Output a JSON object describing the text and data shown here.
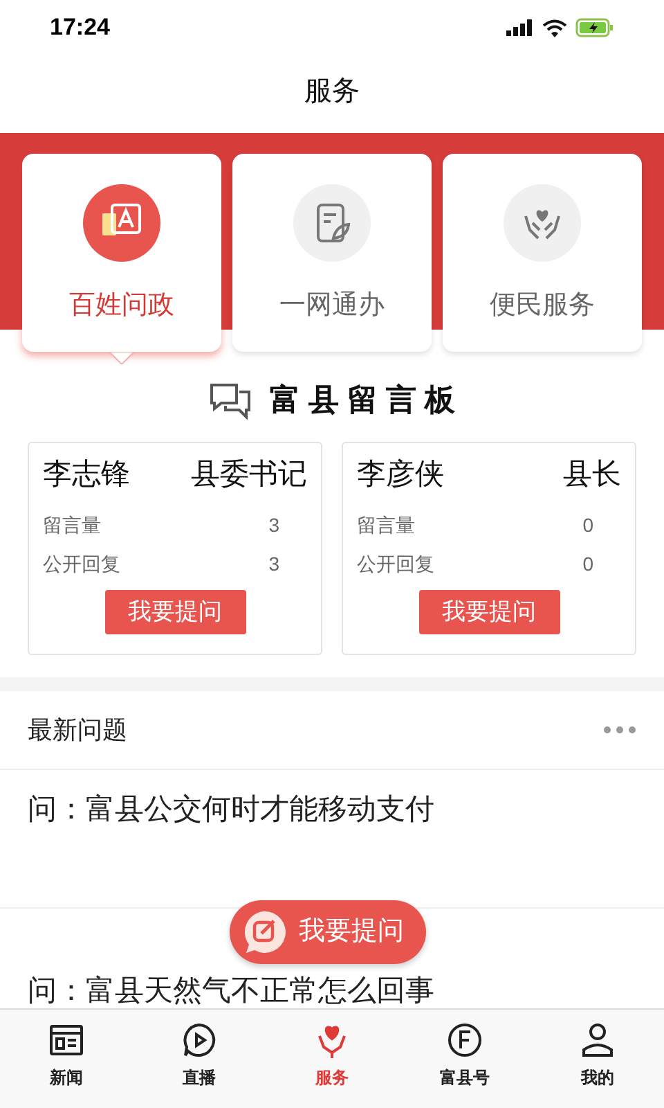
{
  "status_bar": {
    "time": "17:24"
  },
  "header": {
    "title": "服务"
  },
  "services": [
    {
      "label": "百姓问政",
      "kind": "ask",
      "selected": true
    },
    {
      "label": "一网通办",
      "kind": "doc",
      "selected": false
    },
    {
      "label": "便民服务",
      "kind": "care",
      "selected": false
    }
  ],
  "board": {
    "title": "富 县 留 言 板",
    "leaders": [
      {
        "name": "李志锋",
        "position": "县委书记",
        "stats": [
          {
            "label": "留言量",
            "value": "3"
          },
          {
            "label": "公开回复",
            "value": "3"
          }
        ],
        "button": "我要提问"
      },
      {
        "name": "李彦侠",
        "position": "县长",
        "stats": [
          {
            "label": "留言量",
            "value": "0"
          },
          {
            "label": "公开回复",
            "value": "0"
          }
        ],
        "button": "我要提问"
      }
    ]
  },
  "latest": {
    "title": "最新问题",
    "questions": [
      "问：富县公交何时才能移动支付",
      "问：富县天然气不正常怎么回事"
    ]
  },
  "fab": {
    "label": "我要提问"
  },
  "tabs": [
    {
      "label": "新闻",
      "kind": "news",
      "selected": false
    },
    {
      "label": "直播",
      "kind": "live",
      "selected": false
    },
    {
      "label": "服务",
      "kind": "service",
      "selected": true
    },
    {
      "label": "富县号",
      "kind": "account",
      "selected": false
    },
    {
      "label": "我的",
      "kind": "me",
      "selected": false
    }
  ]
}
